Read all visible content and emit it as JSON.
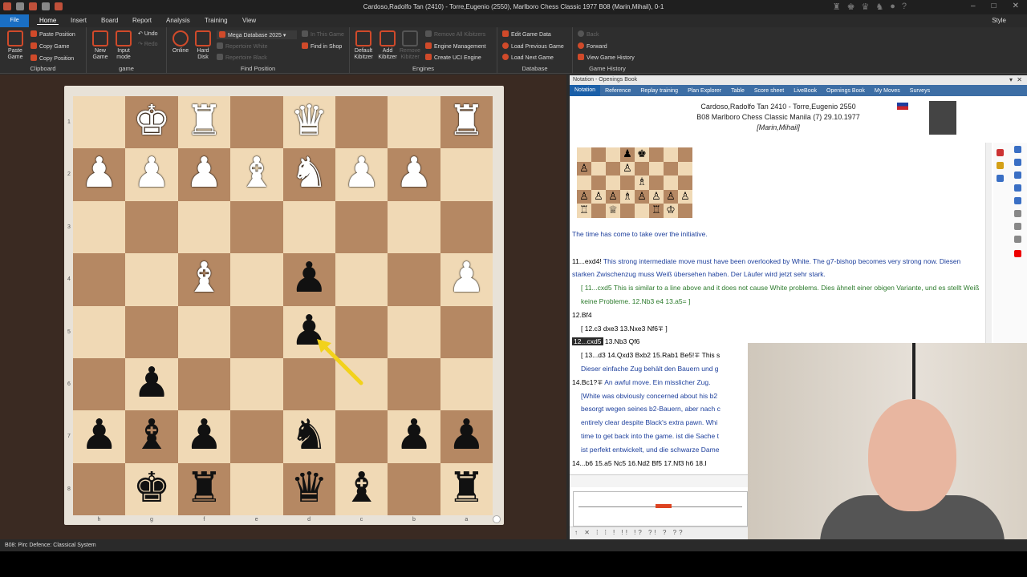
{
  "window": {
    "title": "Cardoso,Radolfo Tan (2410) - Torre,Eugenio (2550), Marlboro Chess Classic 1977  B08  (Marin,Mihail), 0-1",
    "style_label": "Style"
  },
  "menu": {
    "file": "File",
    "items": [
      "Home",
      "Insert",
      "Board",
      "Report",
      "Analysis",
      "Training",
      "View"
    ]
  },
  "ribbon": {
    "clipboard": {
      "label": "Clipboard",
      "paste_game": "Paste Game",
      "paste_position": "Paste Position",
      "copy_game": "Copy Game",
      "copy_position": "Copy Position"
    },
    "game": {
      "label": "game",
      "new_game": "New Game",
      "input_mode": "Input mode",
      "undo": "Undo",
      "redo": "Redo"
    },
    "find_position": {
      "label": "Find Position",
      "online": "Online",
      "hard_disk": "Hard Disk",
      "database": "Mega Database 2025",
      "in_this_game": "In This Game",
      "find_in_shop": "Find in Shop",
      "repertoire_white": "Repertoire White",
      "repertoire_black": "Repertoire Black"
    },
    "engines": {
      "label": "Engines",
      "default_kibitzer": "Default Kibitzer",
      "add_kibitzer": "Add Kibitzer",
      "remove_kibitzer": "Remove Kibitzer",
      "remove_all": "Remove All Kibitzers",
      "engine_management": "Engine Management",
      "create_uci": "Create UCI Engine"
    },
    "database": {
      "label": "Database",
      "edit_game_data": "Edit Game Data",
      "load_previous": "Load Previous Game",
      "load_next": "Load Next Game"
    },
    "game_history": {
      "label": "Game History",
      "back": "Back",
      "forward": "Forward",
      "view_history": "View Game History"
    }
  },
  "board": {
    "ranks": [
      "1",
      "2",
      "3",
      "4",
      "5",
      "6",
      "7",
      "8"
    ],
    "files": [
      "h",
      "g",
      "f",
      "e",
      "d",
      "c",
      "b",
      "a"
    ]
  },
  "status": {
    "text": "B08: Pirc Defence: Classical System"
  },
  "notation": {
    "panel_title": "Notation - Openings Book",
    "tabs": [
      "Notation",
      "Reference",
      "Replay training",
      "Plan Explorer",
      "Table",
      "Score sheet",
      "LiveBook",
      "Openings Book",
      "My Moves",
      "Surveys"
    ],
    "header": {
      "players": "Cardoso,Radolfo Tan 2410 - Torre,Eugenio 2550",
      "event": "B08 Marlboro Chess Classic Manila (7) 29.10.1977",
      "annotator": "[Marin,Mihail]"
    },
    "lines": {
      "l1": "The time has come to take over the initiative.",
      "l2_move": "11...exd4!",
      "l2_text": " This strong intermediate move must have been overlooked by White. The g7-bishop becomes very strong now. Diesen starken Zwischenzug muss Weiß übersehen haben. Der Läufer wird jetzt sehr stark.",
      "l3": "[ 11...cxd5 This is similar to a line above and it does not cause White problems. Dies ähnelt einer obigen Variante, und es stellt Weiß keine Probleme.  12.Nb3  e4  13.a5= ]",
      "l4": "12.Bf4",
      "l5": "[ 12.c3  dxe3  13.Nxe3  Nf6∓ ]",
      "l6_current": "12...cxd5",
      "l6_rest": " 13.Nb3  Qf6",
      "l7": "[ 13...d3  14.Qxd3  Bxb2  15.Rab1  Be5!∓ This s",
      "l8": "Dieser einfache Zug behält den Bauern und g",
      "l9_move": "14.Bc1?∓",
      "l9_text": " An awful move. Ein misslicher Zug.",
      "l10": "[White was obviously concerned about his b2",
      "l11": "besorgt wegen seines b2-Bauern, aber nach c",
      "l12": "entirely clear despite Black's extra pawn. Whi",
      "l13": "time to get back into the game. ist die Sache t",
      "l14": "ist perfekt entwickelt, und die schwarze Dame",
      "l15": "14...b6  15.a5  Nc5  16.Nd2  Bf5  17.Nf3  h6  18.I"
    },
    "symbols": "↑ ✕ ⁞ ⁞ ! !! !? ?! ? ??"
  },
  "colors": {
    "accent": "#1a6fc4",
    "light_square": "#f0d9b5",
    "dark_square": "#b58863",
    "annotation_blue": "#1d3f9c",
    "annotation_green": "#2b7a2b",
    "arrow": "#f2d21b"
  }
}
